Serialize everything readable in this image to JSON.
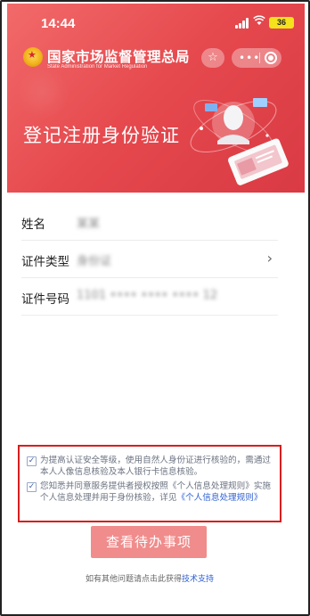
{
  "status_bar": {
    "time": "14:44",
    "battery": "36"
  },
  "brand": {
    "name_cn": "国家市场监督管理总局",
    "name_en": "State Administration for Market Regulation"
  },
  "header": {
    "title": "登记注册身份验证"
  },
  "form": {
    "rows": [
      {
        "label": "姓名",
        "value": "某某"
      },
      {
        "label": "证件类型",
        "value": "身份证"
      },
      {
        "label": "证件号码",
        "value": "1101 •••• •••• •••• 12"
      }
    ]
  },
  "consents": [
    {
      "checked": true,
      "text": "为提高认证安全等级，使用自然人身份证进行核验的，需通过本人人像信息核验及本人银行卡信息核验。"
    },
    {
      "checked": true,
      "text_prefix": "您知悉并同意服务提供者授权按照《个人信息处理规则》实施个人信息处理并用于身份核验，详见",
      "link": "《个人信息处理规则》"
    }
  ],
  "primary_button": "查看待办事项",
  "help": {
    "text": "如有其他问题请点击此获得",
    "link": "技术支持"
  },
  "colors": {
    "header_red": "#e5484d",
    "button": "#f08c8c",
    "link": "#2d5fd3",
    "highlight_border": "#d81e1e"
  }
}
